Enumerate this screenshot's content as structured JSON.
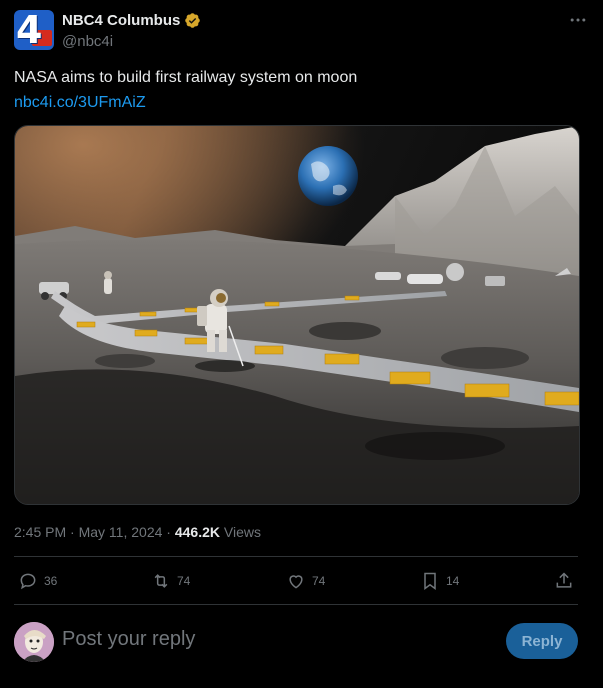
{
  "author": {
    "display_name": "NBC4 Columbus",
    "handle": "@nbc4i",
    "avatar_glyph": "4",
    "verified_badge_color": "#d7a72b"
  },
  "more_menu": {
    "icon": "more-horizontal-icon"
  },
  "tweet": {
    "text": "NASA aims to build first railway system on moon",
    "link": "nbc4i.co/3UFmAiZ"
  },
  "meta": {
    "time": "2:45 PM",
    "separator": " · ",
    "date": "May 11, 2024",
    "views_count": "446.2K",
    "views_label": "Views"
  },
  "actions": {
    "replies": "36",
    "reposts": "74",
    "likes": "74",
    "bookmarks": "14"
  },
  "reply": {
    "placeholder": "Post your reply",
    "button_label": "Reply"
  },
  "colors": {
    "accent": "#1d9bf0",
    "muted": "#71767b",
    "reply_button": "#1a6099"
  }
}
